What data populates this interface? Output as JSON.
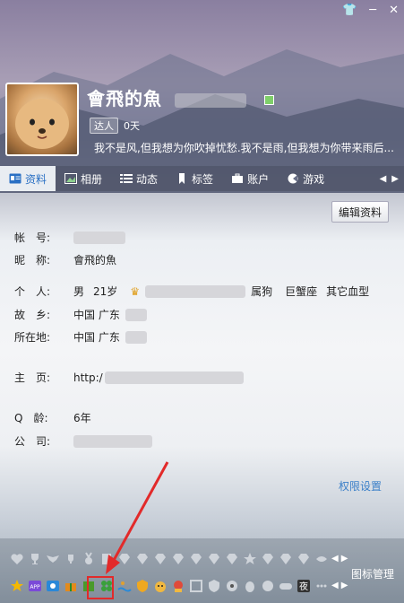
{
  "window": {
    "buttons": [
      "shirt-icon",
      "minimize-icon",
      "close-icon"
    ],
    "minimize": "─",
    "close": "✕"
  },
  "profile": {
    "nickname": "會飛的魚",
    "badge_label": "达人",
    "days": "0天",
    "signature": "我不是风,但我想为你吹掉忧愁.我不是雨,但我想为你带来雨后..."
  },
  "tabs": [
    {
      "label": "资料",
      "icon": "profile-card-icon",
      "active": true
    },
    {
      "label": "相册",
      "icon": "photo-icon"
    },
    {
      "label": "动态",
      "icon": "list-icon"
    },
    {
      "label": "标签",
      "icon": "bookmark-icon"
    },
    {
      "label": "账户",
      "icon": "briefcase-icon"
    },
    {
      "label": "游戏",
      "icon": "game-icon"
    }
  ],
  "edit_button": "编辑资料",
  "fields": {
    "account_label": "帐　号:",
    "nick_label": "昵　称:",
    "nick_value": "會飛的魚",
    "personal_label": "个　人:",
    "personal_value": [
      "男",
      "21岁",
      "属狗",
      "巨蟹座",
      "其它血型"
    ],
    "hometown_label": "故　乡:",
    "hometown_value": "中国 广东",
    "location_label": "所在地:",
    "location_value": "中国 广东",
    "homepage_label": "主　页:",
    "homepage_value": "http:/",
    "qage_label": "Q　龄:",
    "qage_value": "6年",
    "company_label": "公　司:"
  },
  "permission_link": "权限设置",
  "icon_manager": "图标管理",
  "colors": {
    "accent": "#3a7fc8",
    "highlight": "#e22a2a"
  }
}
